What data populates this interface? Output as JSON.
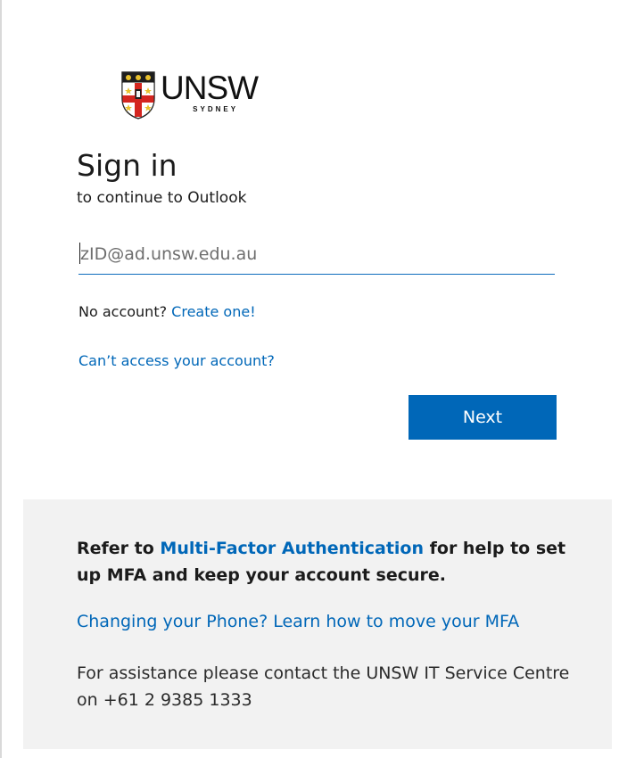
{
  "logo": {
    "wordmark": "UNSW",
    "subtitle": "SYDNEY",
    "crest_icon": "unsw-crest-icon"
  },
  "signin": {
    "title": "Sign in",
    "subtitle": "to continue to Outlook",
    "email_placeholder": "zID@ad.unsw.edu.au",
    "email_value": "",
    "no_account_text": "No account?",
    "create_link": "Create one!",
    "cant_access_link": "Can’t access your account?",
    "next_label": "Next"
  },
  "info": {
    "mfa_prefix": "Refer to ",
    "mfa_link": "Multi-Factor Authentication",
    "mfa_suffix": " for help to set up MFA and keep your account secure.",
    "phone_link": "Changing your Phone? Learn how to move your MFA",
    "assistance": "For assistance please contact the UNSW IT Service Centre on +61 2 9385 1333"
  },
  "colors": {
    "accent": "#0067b8",
    "panel_bg": "#f2f2f2",
    "text": "#1b1b1b"
  }
}
